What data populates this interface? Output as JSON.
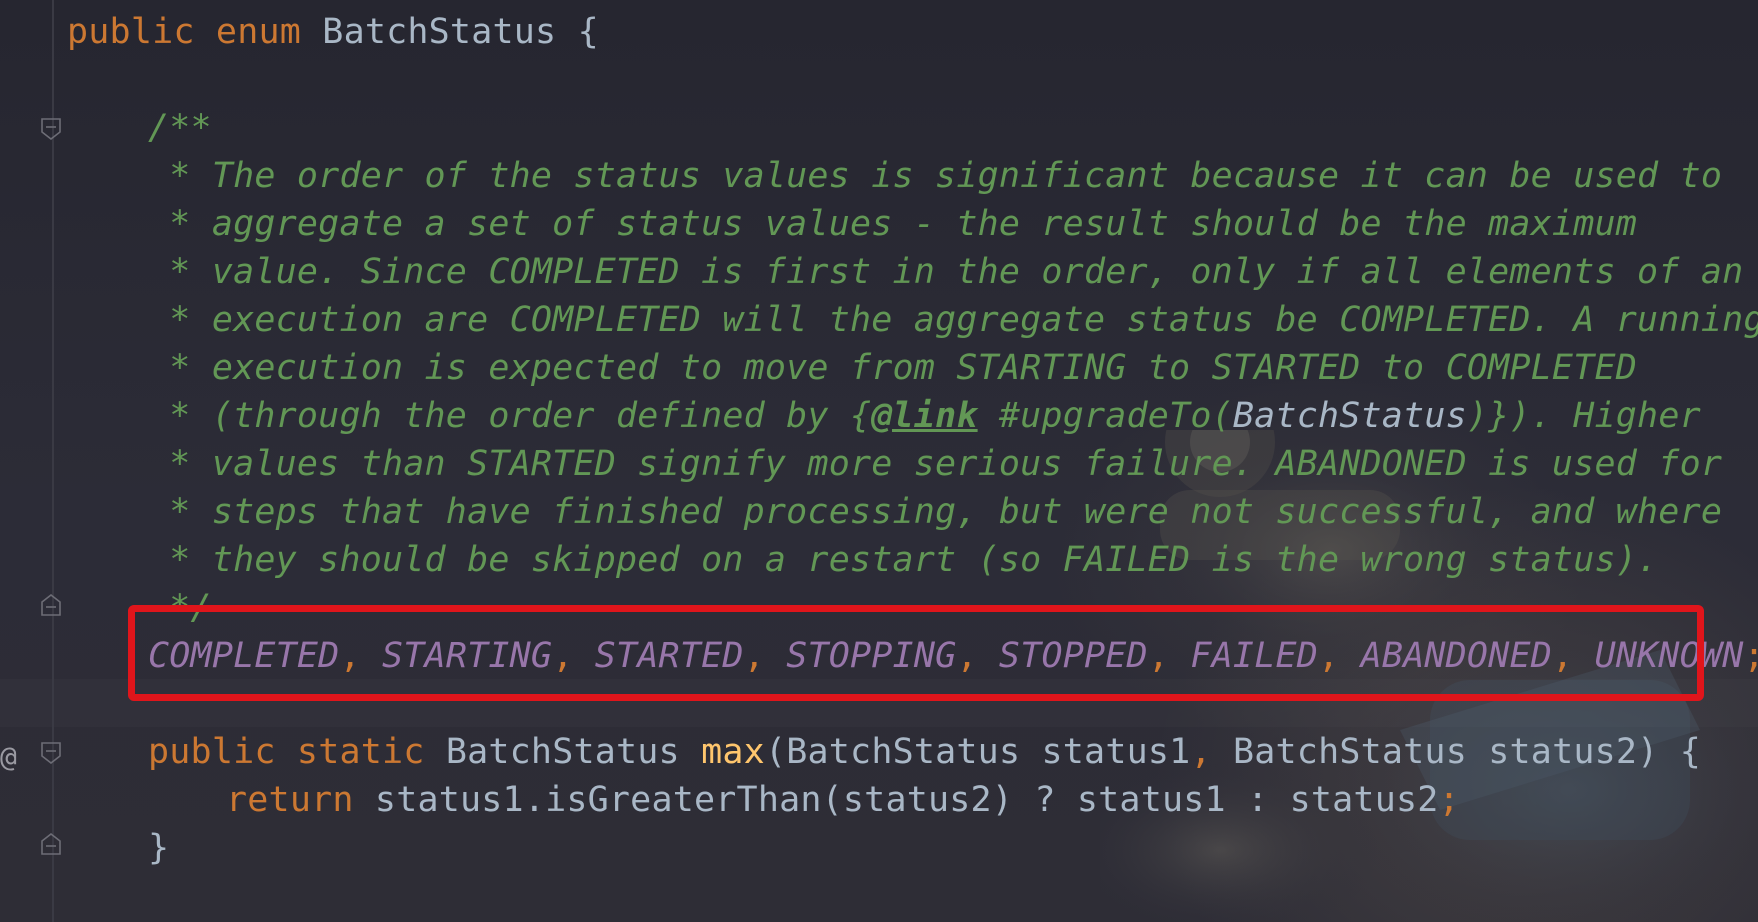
{
  "editor": {
    "gutter_marker": "@",
    "lines": {
      "enum_decl": {
        "kw1": "public",
        "kw2": "enum",
        "name": "BatchStatus",
        "brace": "{"
      },
      "doc_open": "/**",
      "doc1": " * The order of the status values is significant because it can be used to",
      "doc2": " * aggregate a set of status values - the result should be the maximum",
      "doc3": " * value. Since COMPLETED is first in the order, only if all elements of an",
      "doc4": " * execution are COMPLETED will the aggregate status be COMPLETED. A running",
      "doc5": " * execution is expected to move from STARTING to STARTED to COMPLETED",
      "doc6": {
        "before": " * (through the order defined by {",
        "tag": "@link",
        "middle": " #upgradeTo(",
        "ref": "BatchStatus",
        "after": ")}). Higher"
      },
      "doc7": " * values than STARTED signify more serious failure. ABANDONED is used for",
      "doc8": " * steps that have finished processing, but were not successful, and where",
      "doc9": " * they should be skipped on a restart (so FAILED is the wrong status).",
      "doc_close": " */",
      "constants": [
        "COMPLETED",
        "STARTING",
        "STARTED",
        "STOPPING",
        "STOPPED",
        "FAILED",
        "ABANDONED",
        "UNKNOWN"
      ],
      "separator": ", ",
      "terminator": ";",
      "method_sig": {
        "kw1": "public",
        "kw2": "static",
        "type1": "BatchStatus",
        "name": "max",
        "open": "(",
        "ptype1": "BatchStatus",
        "param1": "status1",
        "comma": ",",
        "ptype2": "BatchStatus",
        "param2": "status2",
        "close": ") {"
      },
      "return_stmt": {
        "kw": "return",
        "expr": "status1.isGreaterThan(status2) ? status1 : status2",
        "semi": ";"
      },
      "close_brace": "}"
    },
    "highlight_color": "#e0151b"
  }
}
